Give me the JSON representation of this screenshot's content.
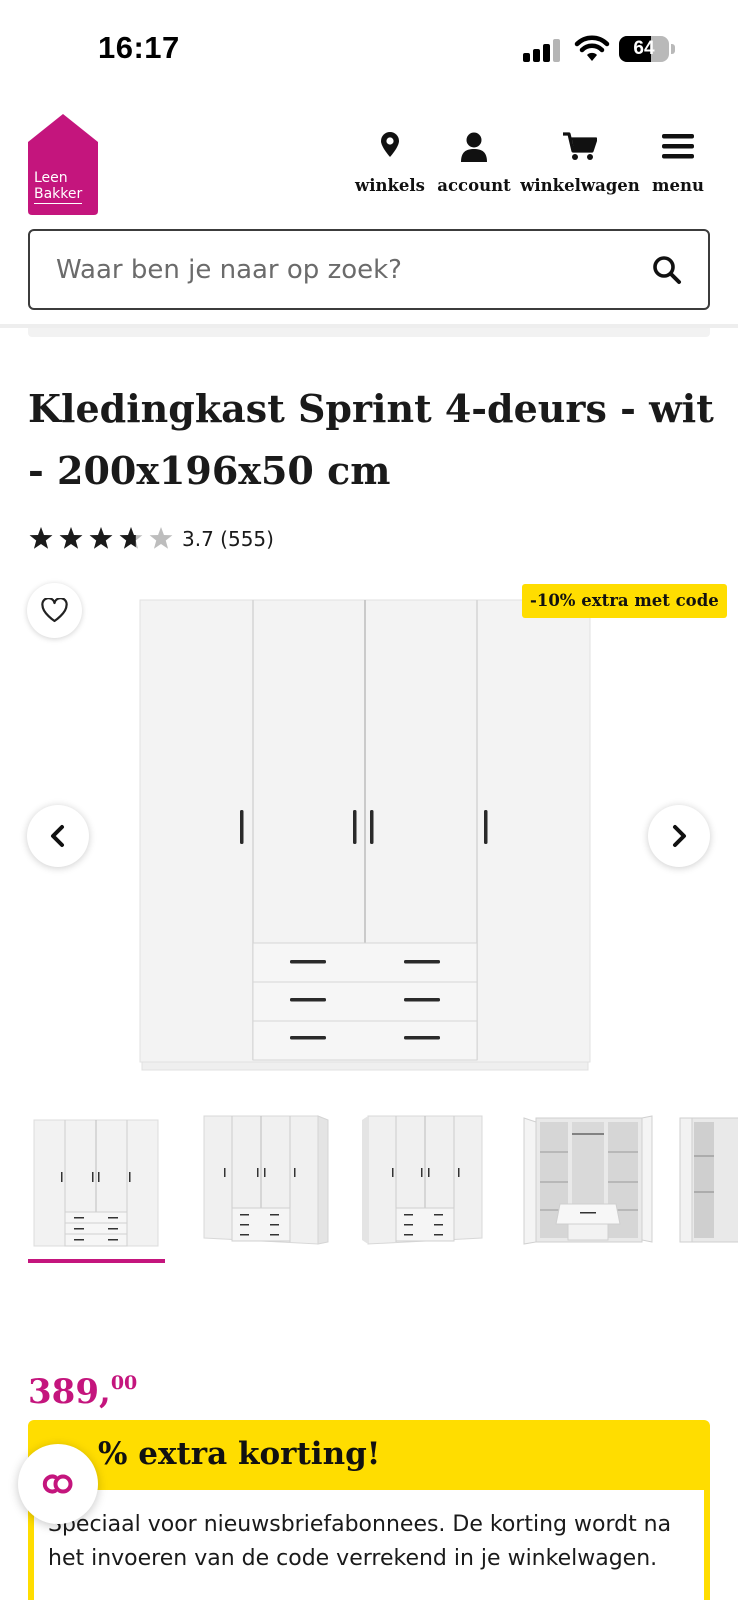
{
  "status_bar": {
    "time": "16:17",
    "battery_level": "64",
    "icons": [
      "cellular-signal-icon",
      "wifi-icon",
      "battery-icon"
    ]
  },
  "header": {
    "logo_line1": "Leen",
    "logo_line2": "Bakker",
    "brand_color": "#c4157d",
    "nav": {
      "stores_label": "winkels",
      "account_label": "account",
      "cart_label": "winkelwagen",
      "menu_label": "menu"
    },
    "nav_icons": [
      "map-pin-icon",
      "user-icon",
      "cart-icon",
      "hamburger-menu-icon"
    ]
  },
  "search": {
    "placeholder": "Waar ben je naar op zoek?",
    "icon": "search-icon"
  },
  "product": {
    "title": "Kledingkast Sprint 4-deurs - wit - 200x196x50 cm",
    "rating_value": 3.7,
    "rating_text": "3.7 (555)",
    "stars_max": 5
  },
  "gallery": {
    "promo_badge": "-10% extra met code",
    "promo_color": "#ffdd00",
    "thumbnail_count_visible": 5,
    "selected_thumbnail": 1,
    "icons": [
      "heart-icon",
      "chevron-left-icon",
      "chevron-right-icon"
    ]
  },
  "pricing": {
    "price_whole": "389,",
    "price_cents": "00"
  },
  "promo_box": {
    "title": "% extra korting!",
    "text": "Speciaal voor nieuwsbriefabonnees. De korting wordt na het invoeren van de code verrekend in je winkelwagen."
  },
  "chat": {
    "icon": "chat-icon"
  }
}
